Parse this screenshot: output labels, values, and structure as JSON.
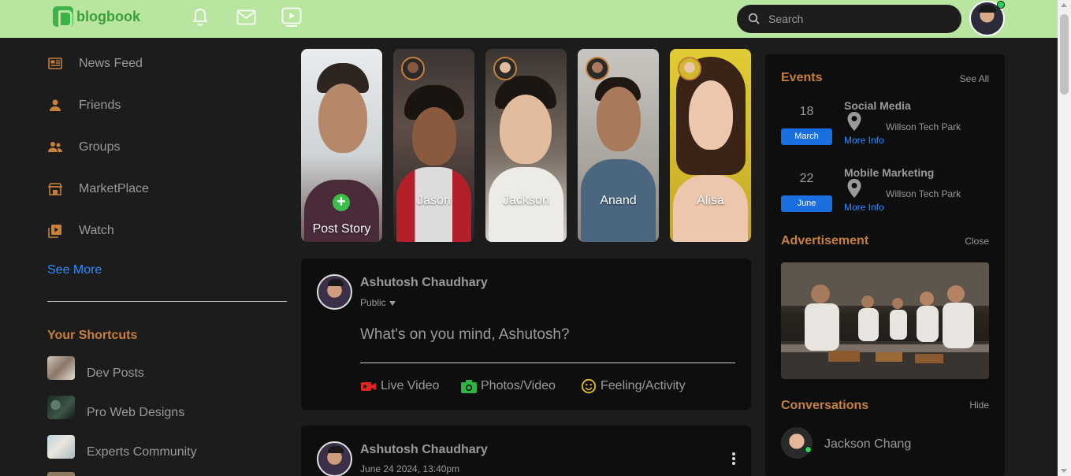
{
  "app": {
    "name": "blogbook"
  },
  "search": {
    "placeholder": "Search"
  },
  "sidebar": {
    "items": [
      {
        "label": "News Feed",
        "icon": "news-feed-icon"
      },
      {
        "label": "Friends",
        "icon": "friends-icon"
      },
      {
        "label": "Groups",
        "icon": "groups-icon"
      },
      {
        "label": "MarketPlace",
        "icon": "marketplace-icon"
      },
      {
        "label": "Watch",
        "icon": "watch-icon"
      }
    ],
    "see_more": "See More",
    "shortcuts_title": "Your Shortcuts",
    "shortcuts": [
      {
        "label": "Dev Posts"
      },
      {
        "label": "Pro Web Designs"
      },
      {
        "label": "Experts Community"
      }
    ]
  },
  "stories": [
    {
      "name": "Post Story"
    },
    {
      "name": "Jason"
    },
    {
      "name": "Jackson"
    },
    {
      "name": "Anand"
    },
    {
      "name": "Alisa"
    }
  ],
  "create_post": {
    "user": "Ashutosh Chaudhary",
    "privacy": "Public",
    "prompt": "What's on you mind, Ashutosh?",
    "actions": [
      {
        "label": "Live Video",
        "icon": "live-video-icon",
        "color": "#e02424"
      },
      {
        "label": "Photos/Video",
        "icon": "camera-icon",
        "color": "#2fb344"
      },
      {
        "label": "Feeling/Activity",
        "icon": "smiley-icon",
        "color": "#e3c10e"
      }
    ]
  },
  "post": {
    "user": "Ashutosh Chaudhary",
    "date": "June 24 2024, 13:40pm"
  },
  "events": {
    "title": "Events",
    "see_all": "See All",
    "items": [
      {
        "day": "18",
        "month": "March",
        "title": "Social Media",
        "location": "Willson Tech Park",
        "more": "More Info"
      },
      {
        "day": "22",
        "month": "June",
        "title": "Mobile Marketing",
        "location": "Willson Tech Park",
        "more": "More Info"
      }
    ]
  },
  "advertisement": {
    "title": "Advertisement",
    "close": "Close"
  },
  "conversations": {
    "title": "Conversations",
    "hide": "Hide",
    "items": [
      {
        "name": "Jackson Chang"
      }
    ]
  },
  "colors": {
    "topbar": "#b8e6a0",
    "accent": "#c6803a",
    "link": "#2d8cff",
    "online": "#2bd15a"
  }
}
